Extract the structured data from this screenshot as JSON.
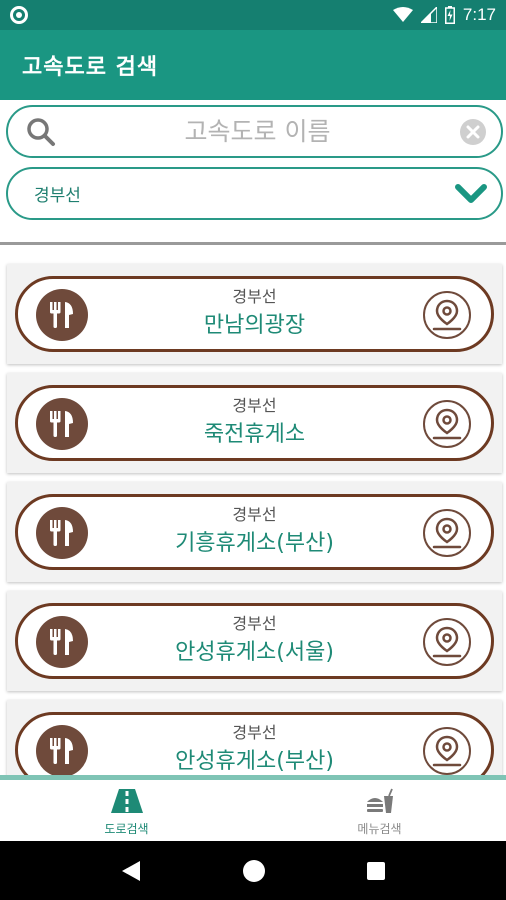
{
  "status_bar": {
    "time": "7:17"
  },
  "app_bar": {
    "title": "고속도로 검색"
  },
  "search": {
    "placeholder": "고속도로 이름",
    "value": ""
  },
  "filter": {
    "selected": "경부선"
  },
  "results": [
    {
      "route": "경부선",
      "name": "만남의광장"
    },
    {
      "route": "경부선",
      "name": "죽전휴게소"
    },
    {
      "route": "경부선",
      "name": "기흥휴게소(부산)"
    },
    {
      "route": "경부선",
      "name": "안성휴게소(서울)"
    },
    {
      "route": "경부선",
      "name": "안성휴게소(부산)"
    }
  ],
  "bottom_nav": [
    {
      "label": "도로검색",
      "icon": "road-icon",
      "active": true
    },
    {
      "label": "메뉴검색",
      "icon": "food-drink-icon",
      "active": false
    }
  ],
  "colors": {
    "primary": "#1a9682",
    "status_bar": "#157f70",
    "accent_brown": "#6d3a22",
    "text_green": "#1e8a76"
  }
}
